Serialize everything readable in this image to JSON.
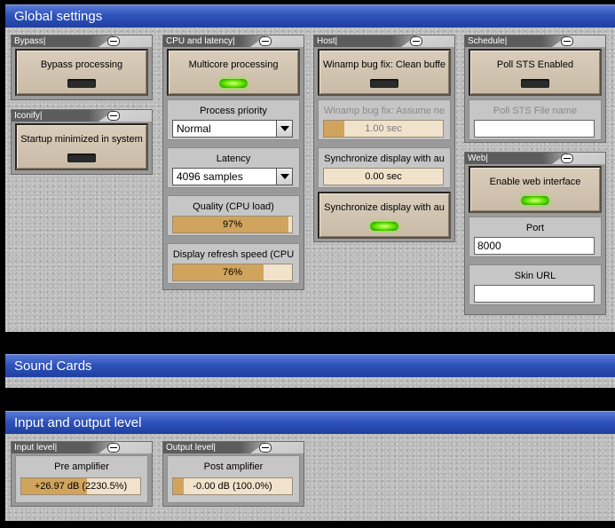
{
  "global": {
    "title": "Global settings",
    "bypass": {
      "title": "Bypass|",
      "button": "Bypass processing"
    },
    "iconify": {
      "title": "Iconify|",
      "button": "Startup minimized in system"
    },
    "cpu": {
      "title": "CPU and latency|",
      "multicore": "Multicore processing",
      "priority_label": "Process priority",
      "priority_value": "Normal",
      "latency_label": "Latency",
      "latency_value": "4096 samples",
      "quality_label": "Quality (CPU load)",
      "quality_value": "97%",
      "quality_fraction": 0.97,
      "refresh_label": "Display refresh speed (CPU",
      "refresh_value": "76%",
      "refresh_fraction": 0.76
    },
    "host": {
      "title": "Host|",
      "clean_buffer": "Winamp bug fix: Clean buffe",
      "assume_label": "Winamp bug fix: Assume ne",
      "assume_value": "1.00 sec",
      "assume_fraction": 0.17,
      "sync_label": "Synchronize display with au",
      "sync_value": "0.00 sec",
      "sync_button": "Synchronize display with au"
    },
    "schedule": {
      "title": "Schedule|",
      "poll_button": "Poll STS Enabled",
      "file_label": "Poll STS File name",
      "file_value": ""
    },
    "web": {
      "title": "Web|",
      "enable_button": "Enable web interface",
      "port_label": "Port",
      "port_value": "8000",
      "skin_label": "Skin URL",
      "skin_value": ""
    }
  },
  "sound": {
    "title": "Sound Cards"
  },
  "io": {
    "title": "Input and output level",
    "input": {
      "title": "Input level|",
      "label": "Pre amplifier",
      "value": "+26.97 dB (2230.5%)",
      "fraction": 0.55
    },
    "output": {
      "title": "Output level|",
      "label": "Post amplifier",
      "value": "-0.00 dB (100.0%)",
      "fraction": 0.09
    }
  },
  "colors": {
    "header_blue": "#2f53bb",
    "slider_fill": "#d0a45c",
    "led_on": "#66e800"
  }
}
